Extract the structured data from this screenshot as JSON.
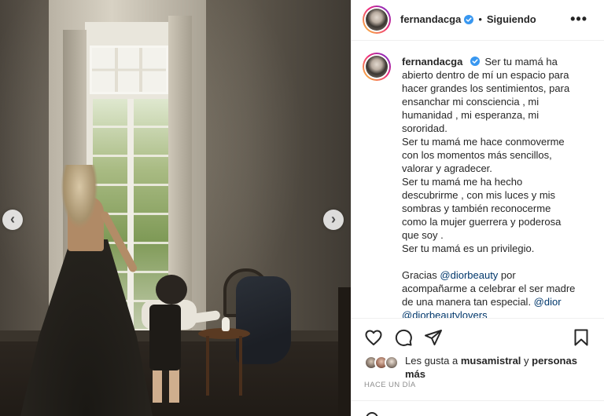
{
  "post": {
    "username": "fernandacga",
    "separator": "•",
    "follow_status": "Siguiendo",
    "more_label": "•••",
    "caption_lines": [
      "Ser tu mamá ha",
      "abierto dentro de mí un espacio para",
      "hacer grandes los sentimientos, para",
      "ensanchar mi consciencia , mi",
      "humanidad , mi esperanza, mi",
      "sororidad.",
      "Ser tu mamá me hace conmoverme",
      "con los momentos más sencillos,",
      "valorar y agradecer.",
      "Ser tu mamá me ha hecho",
      "descubrirme , con mis luces y mis",
      "sombras y también reconocerme",
      "como la mujer guerrera y poderosa",
      "que soy .",
      "Ser tu mamá es un privilegio."
    ],
    "thanks": {
      "pre": "Gracias ",
      "mention1": "@diorbeauty",
      "mid1": " por",
      "line2": "acompañarme a celebrar el ser madre",
      "line3_pre": "de una manera tan especial. ",
      "mention2": "@dior",
      "mention3": "@diorbeautylovers"
    },
    "likes": {
      "prefix": "Les gusta a ",
      "user": "musamistral",
      "middle": " y ",
      "suffix": "personas más"
    },
    "timestamp": "HACE UN DÍA",
    "carousel": {
      "prev_icon": "‹",
      "next_icon": "›"
    }
  },
  "colors": {
    "verified": "#3897f0",
    "link": "#00376b",
    "muted": "#8e8e8e",
    "text": "#262626"
  },
  "icons": [
    "heart-icon",
    "comment-icon",
    "share-icon",
    "bookmark-icon",
    "verified-badge-icon",
    "more-options-icon",
    "chevron-left-icon",
    "chevron-right-icon"
  ]
}
